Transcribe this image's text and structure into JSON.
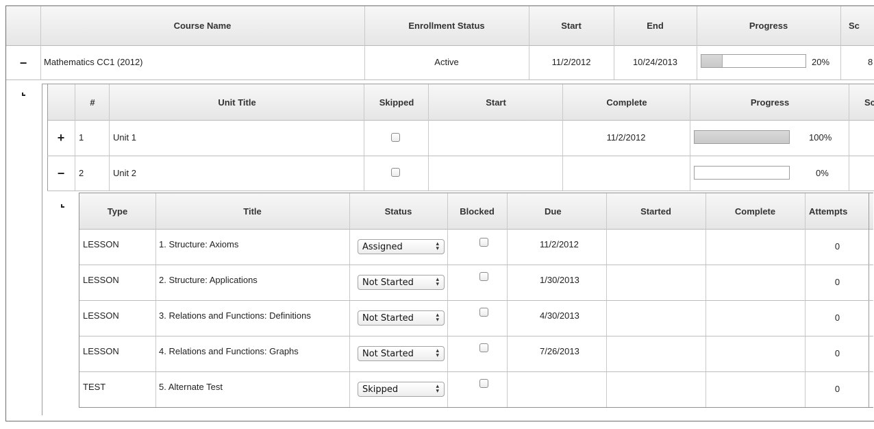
{
  "courses_table": {
    "headers": [
      "Course Name",
      "Enrollment Status",
      "Start",
      "End",
      "Progress",
      "Sc"
    ],
    "row": {
      "toggle": "−",
      "name": "Mathematics CC1 (2012)",
      "status": "Active",
      "start": "11/2/2012",
      "end": "10/24/2013",
      "progress": 20,
      "progress_text": "20%",
      "score_partial": "8"
    }
  },
  "units_table": {
    "headers": [
      "#",
      "Unit Title",
      "Skipped",
      "Start",
      "Complete",
      "Progress",
      "Sc"
    ],
    "rows": [
      {
        "toggle": "+",
        "num": "1",
        "title": "Unit 1",
        "skipped": false,
        "start": "",
        "complete": "11/2/2012",
        "progress": 100,
        "progress_text": "100%"
      },
      {
        "toggle": "−",
        "num": "2",
        "title": "Unit 2",
        "skipped": false,
        "start": "",
        "complete": "",
        "progress": 0,
        "progress_text": "0%"
      }
    ]
  },
  "activities_table": {
    "headers": [
      "Type",
      "Title",
      "Status",
      "Blocked",
      "Due",
      "Started",
      "Complete",
      "Attempts"
    ],
    "rows": [
      {
        "type": "LESSON",
        "title": "1. Structure: Axioms",
        "status": "Assigned",
        "blocked": false,
        "due": "11/2/2012",
        "started": "",
        "complete": "",
        "attempts": "0"
      },
      {
        "type": "LESSON",
        "title": "2. Structure: Applications",
        "status": "Not Started",
        "blocked": false,
        "due": "1/30/2013",
        "started": "",
        "complete": "",
        "attempts": "0"
      },
      {
        "type": "LESSON",
        "title": "3. Relations and Functions: Definitions",
        "status": "Not Started",
        "blocked": false,
        "due": "4/30/2013",
        "started": "",
        "complete": "",
        "attempts": "0"
      },
      {
        "type": "LESSON",
        "title": "4. Relations and Functions: Graphs",
        "status": "Not Started",
        "blocked": false,
        "due": "7/26/2013",
        "started": "",
        "complete": "",
        "attempts": "0"
      },
      {
        "type": "TEST",
        "title": "5. Alternate Test",
        "status": "Skipped",
        "blocked": false,
        "due": "",
        "started": "",
        "complete": "",
        "attempts": "0"
      }
    ]
  },
  "icons": {
    "expanded": "minus-icon",
    "collapsed": "plus-icon",
    "child": "tree-corner-icon",
    "select": "updown-arrows-icon"
  }
}
